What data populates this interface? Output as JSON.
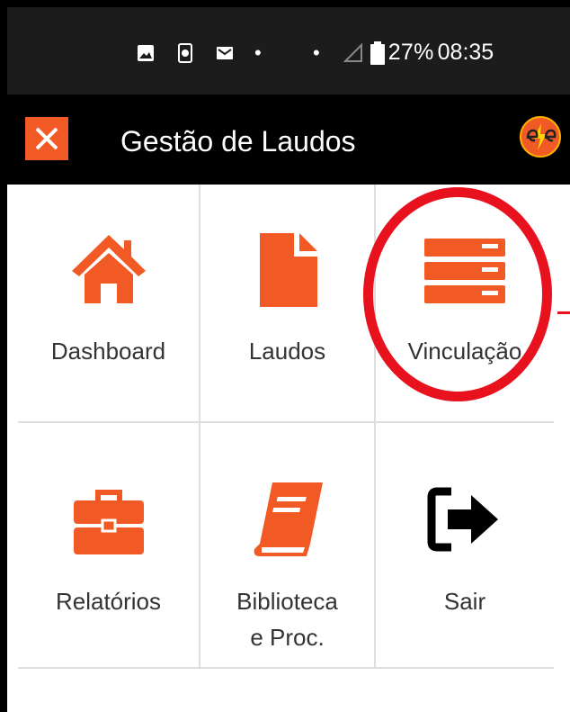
{
  "status_bar": {
    "icons": [
      "image-icon",
      "call-icon",
      "mail-icon"
    ],
    "dots": [
      "•",
      "•"
    ],
    "battery": "27%",
    "time": "08:35"
  },
  "app_bar": {
    "title": "Gestão de Laudos",
    "close_icon": "close-icon",
    "logo_icon": "ere-logo-icon"
  },
  "menu": {
    "items": [
      {
        "label": "Dashboard",
        "icon": "home-icon"
      },
      {
        "label": "Laudos",
        "icon": "document-icon"
      },
      {
        "label": "Vinculação",
        "icon": "server-stack-icon"
      },
      {
        "label": "Relatórios",
        "icon": "briefcase-icon"
      },
      {
        "label": "Biblioteca e Proc.",
        "icon": "book-icon"
      },
      {
        "label": "Sair",
        "icon": "sign-out-icon"
      }
    ]
  },
  "colors": {
    "accent": "#f15a24",
    "highlight": "#e8121f",
    "statusbar": "#1c1c1c",
    "appbar": "#000000"
  }
}
